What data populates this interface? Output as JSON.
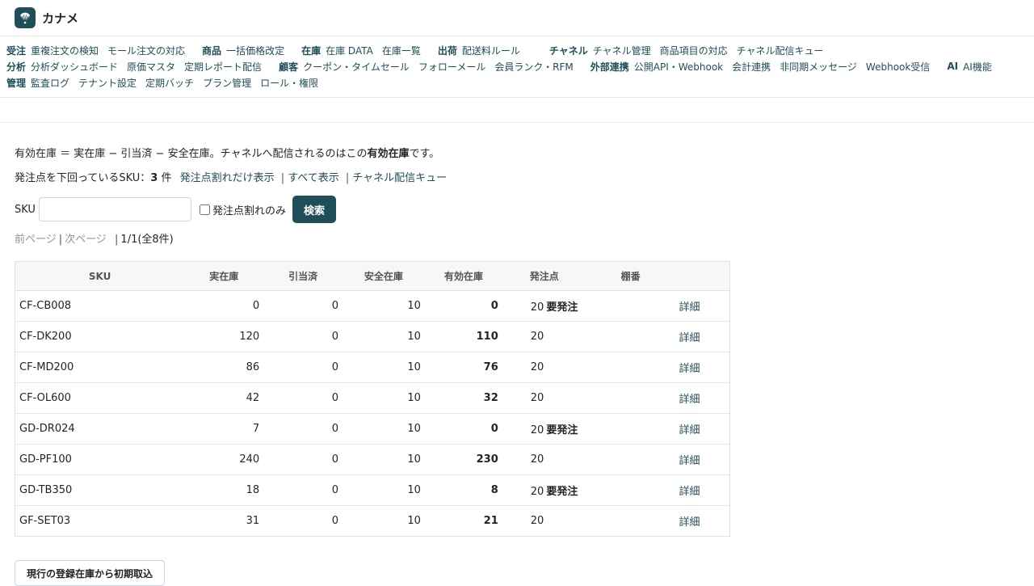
{
  "app": {
    "name": "カナメ"
  },
  "nav": {
    "row1": [
      {
        "cat": "受注",
        "links": [
          "重複注文の検知",
          "モール注文の対応"
        ]
      },
      {
        "cat": "商品",
        "links": [
          "一括価格改定"
        ]
      },
      {
        "cat": "在庫",
        "links": [
          "在庫 DATA",
          "在庫一覧"
        ]
      },
      {
        "cat": "出荷",
        "links": [
          "配送料ルール"
        ]
      },
      {
        "cat": "チャネル",
        "links": [
          "チャネル管理",
          "商品項目の対応",
          "チャネル配信キュー"
        ]
      }
    ],
    "row2": [
      {
        "cat": "分析",
        "links": [
          "分析ダッシュボード",
          "原価マスタ",
          "定期レポート配信"
        ]
      },
      {
        "cat": "顧客",
        "links": [
          "クーポン・タイムセール",
          "フォローメール",
          "会員ランク・RFM"
        ]
      },
      {
        "cat": "外部連携",
        "links": [
          "公開API・Webhook",
          "会計連携",
          "非同期メッセージ",
          "Webhook受信"
        ]
      },
      {
        "cat": "AI",
        "links": [
          "AI機能"
        ]
      }
    ],
    "row3": [
      {
        "cat": "管理",
        "links": [
          "監査ログ",
          "テナント設定",
          "定期バッチ",
          "プラン管理",
          "ロール・権限"
        ]
      }
    ]
  },
  "desc": {
    "part1": "有効在庫 ＝ 実在庫 − 引当済 − 安全在庫。チャネルへ配信されるのはこの",
    "bold": "有効在庫",
    "part2": "です。"
  },
  "reorder": {
    "prefix": "発注点を下回っているSKU：",
    "count": "3",
    "unit": "件",
    "link_filter": "発注点割れだけ表示",
    "link_all": "すべて表示",
    "link_queue": "チャネル配信キュー"
  },
  "search": {
    "sku_label": "SKU",
    "sku_value": "",
    "checkbox_label": "発注点割れのみ",
    "button": "検索"
  },
  "pager": {
    "prev": "前ページ",
    "next": "次ページ",
    "info": "1/1(全8件)"
  },
  "table": {
    "headers": [
      "SKU",
      "実在庫",
      "引当済",
      "安全在庫",
      "有効在庫",
      "発注点",
      "棚番",
      ""
    ],
    "rows": [
      {
        "sku": "CF-CB008",
        "stock": "0",
        "alloc": "0",
        "safety": "10",
        "effective": "0",
        "reorder": "20",
        "flag": "要発注",
        "shelf": "",
        "action": "詳細"
      },
      {
        "sku": "CF-DK200",
        "stock": "120",
        "alloc": "0",
        "safety": "10",
        "effective": "110",
        "reorder": "20",
        "flag": "",
        "shelf": "",
        "action": "詳細"
      },
      {
        "sku": "CF-MD200",
        "stock": "86",
        "alloc": "0",
        "safety": "10",
        "effective": "76",
        "reorder": "20",
        "flag": "",
        "shelf": "",
        "action": "詳細"
      },
      {
        "sku": "CF-OL600",
        "stock": "42",
        "alloc": "0",
        "safety": "10",
        "effective": "32",
        "reorder": "20",
        "flag": "",
        "shelf": "",
        "action": "詳細"
      },
      {
        "sku": "GD-DR024",
        "stock": "7",
        "alloc": "0",
        "safety": "10",
        "effective": "0",
        "reorder": "20",
        "flag": "要発注",
        "shelf": "",
        "action": "詳細"
      },
      {
        "sku": "GD-PF100",
        "stock": "240",
        "alloc": "0",
        "safety": "10",
        "effective": "230",
        "reorder": "20",
        "flag": "",
        "shelf": "",
        "action": "詳細"
      },
      {
        "sku": "GD-TB350",
        "stock": "18",
        "alloc": "0",
        "safety": "10",
        "effective": "8",
        "reorder": "20",
        "flag": "要発注",
        "shelf": "",
        "action": "詳細"
      },
      {
        "sku": "GF-SET03",
        "stock": "31",
        "alloc": "0",
        "safety": "10",
        "effective": "21",
        "reorder": "20",
        "flag": "",
        "shelf": "",
        "action": "詳細"
      }
    ]
  },
  "bottom_button": "現行の登録在庫から初期取込",
  "colors": {
    "accent": "#1f4e59"
  },
  "icons": {
    "logo": "fan-icon"
  }
}
